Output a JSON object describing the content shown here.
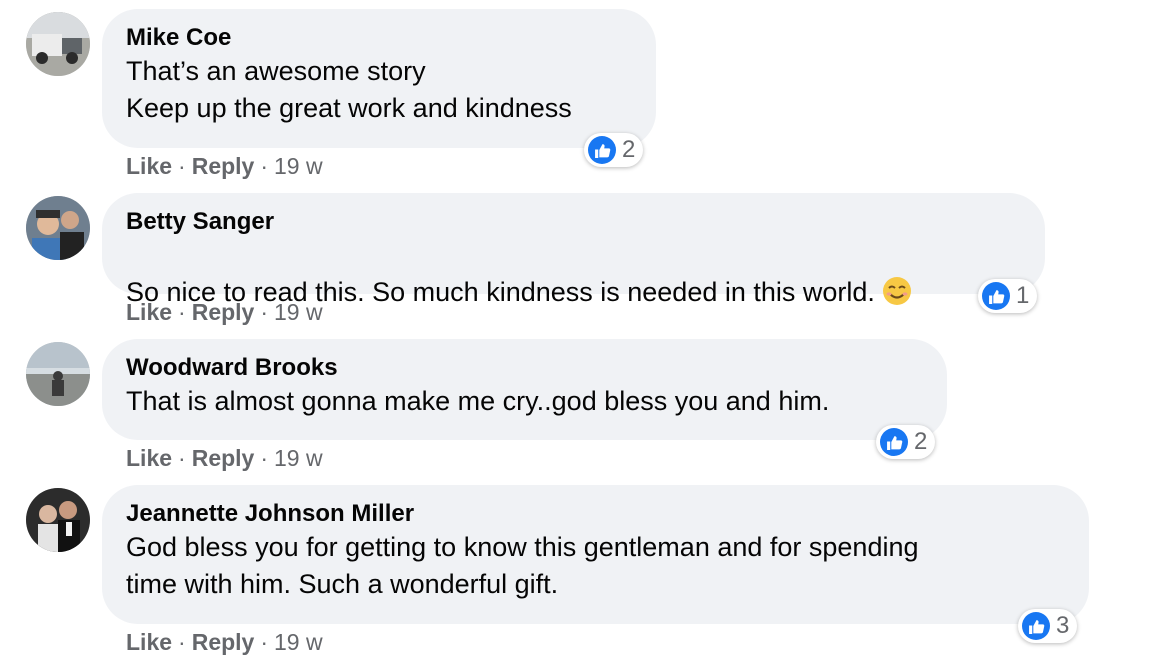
{
  "labels": {
    "like": "Like",
    "reply": "Reply",
    "dot": "·"
  },
  "colors": {
    "bubble": "#f0f2f5",
    "reaction_blue": "#1877f2",
    "meta_gray": "#65676b"
  },
  "comments": [
    {
      "author": "Mike Coe",
      "lines": [
        "That’s an awesome story",
        "Keep up the great work and kindness"
      ],
      "has_emoji": false,
      "reaction_icon": "thumbs-up-icon",
      "reaction_count": "2",
      "time": "19 w"
    },
    {
      "author": "Betty Sanger",
      "lines": [
        "So nice to read this. So much kindness is needed in this world."
      ],
      "has_emoji": true,
      "emoji": "smiling-face-icon",
      "reaction_icon": "thumbs-up-icon",
      "reaction_count": "1",
      "time": "19 w"
    },
    {
      "author": "Woodward Brooks",
      "lines": [
        "That is almost gonna make me cry..god bless you and him."
      ],
      "has_emoji": false,
      "reaction_icon": "thumbs-up-icon",
      "reaction_count": "2",
      "time": "19 w"
    },
    {
      "author": "Jeannette Johnson Miller",
      "lines": [
        "God bless you for getting to know this gentleman and for spending",
        "time with him. Such a wonderful gift."
      ],
      "has_emoji": false,
      "reaction_icon": "thumbs-up-icon",
      "reaction_count": "3",
      "time": "19 w"
    }
  ]
}
